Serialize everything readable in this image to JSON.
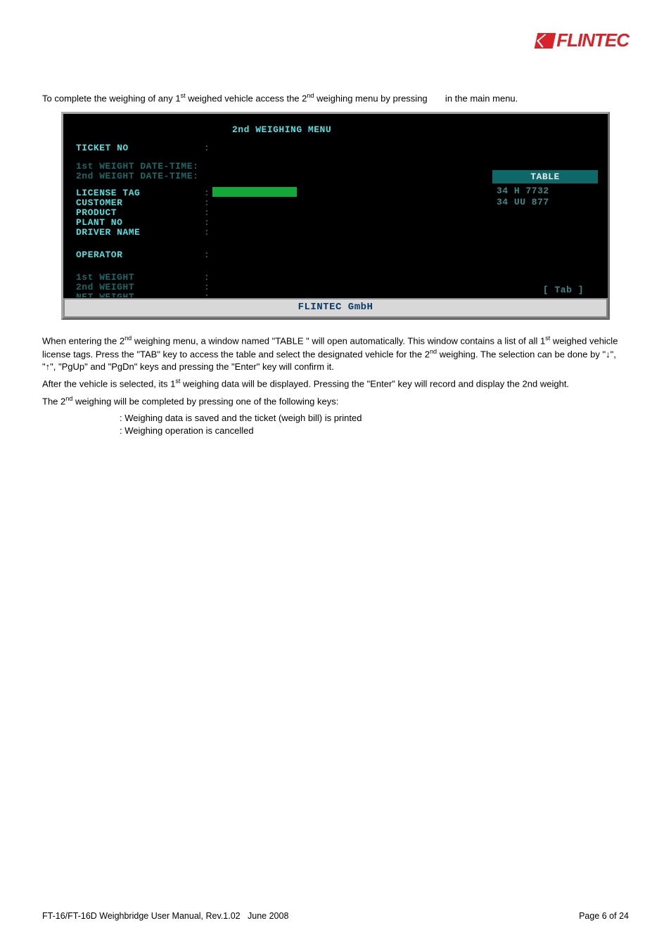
{
  "logo_text": "FLINTEC",
  "intro_para": "To complete the weighing of any 1<sup>st</sup> weighed vehicle access the 2<sup>nd</sup> weighing menu by pressing       in the main menu.",
  "terminal": {
    "title": "2nd WEIGHING MENU",
    "ticket_no": "TICKET NO",
    "dt1": "1st WEIGHT DATE-TIME:",
    "dt2": "2nd WEIGHT DATE-TIME:",
    "license_tag": "LICENSE TAG",
    "customer": "CUSTOMER",
    "product": "PRODUCT",
    "plant_no": "PLANT NO",
    "driver_name": "DRIVER NAME",
    "operator": "OPERATOR",
    "w1": "1st WEIGHT",
    "w2": "2nd WEIGHT",
    "net": "NET WEIGHT",
    "table_header": "TABLE",
    "table_rows": [
      "34 H 7732",
      "34 UU 877"
    ],
    "tab_label": "[ Tab ]",
    "footer": "FLINTEC GmbH"
  },
  "para2": "When entering the 2<sup>nd</sup> weighing menu, a window named \"TABLE \" will open automatically. This window contains a list of all 1<sup>st</sup> weighed vehicle license tags. Press the \"TAB\" key to access the table and select the designated vehicle for the 2<sup>nd</sup> weighing. The selection can be done by \"↓\", \"↑\", \"PgUp\" and \"PgDn\" keys and pressing the \"Enter\" key will confirm it.",
  "para3": "After the vehicle is selected, its 1<sup>st</sup> weighing data will be displayed. Pressing the \"Enter\" key will record and display the 2nd weight.",
  "para4": "The 2<sup>nd</sup> weighing will be completed by pressing one of the following keys:",
  "key_list": [
    "Weighing data is saved and the ticket (weigh bill) is printed",
    "Weighing operation is cancelled"
  ],
  "footer_left": "FT-16/FT-16D Weighbridge User Manual, Rev.1.02   June 2008",
  "footer_right": "Page 6 of 24"
}
